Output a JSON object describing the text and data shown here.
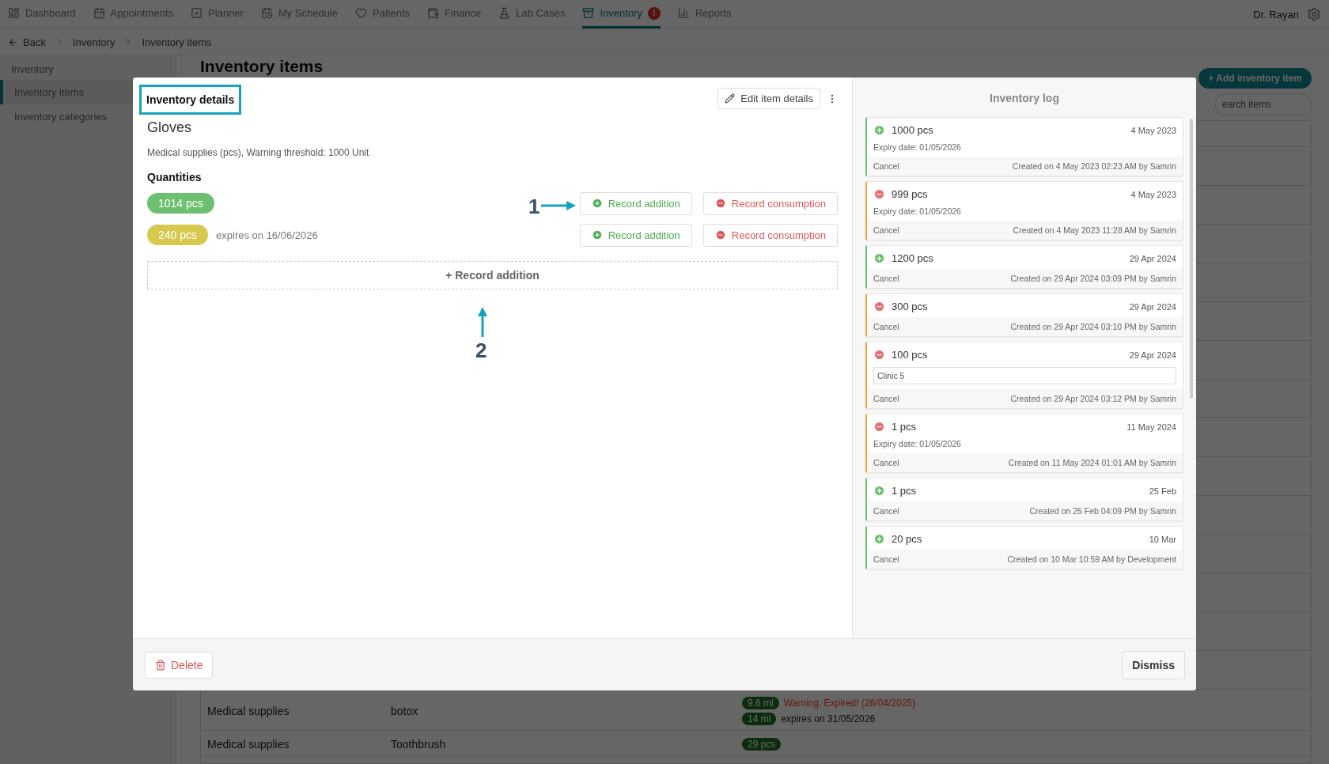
{
  "nav": {
    "items": [
      {
        "label": "Dashboard",
        "selected": false
      },
      {
        "label": "Appointments",
        "selected": false
      },
      {
        "label": "Planner",
        "selected": false
      },
      {
        "label": "My Schedule",
        "selected": false
      },
      {
        "label": "Patients",
        "selected": false
      },
      {
        "label": "Finance",
        "selected": false
      },
      {
        "label": "Lab Cases",
        "selected": false
      },
      {
        "label": "Inventory",
        "selected": true,
        "badge": "!"
      },
      {
        "label": "Reports",
        "selected": false
      }
    ],
    "user": "Dr. Rayan"
  },
  "breadcrumb": {
    "back": "Back",
    "items": [
      "Inventory",
      "Inventory items"
    ]
  },
  "sidebar": {
    "heading": "Inventory",
    "items": [
      {
        "label": "Inventory items",
        "selected": true
      },
      {
        "label": "Inventory categories",
        "selected": false
      }
    ]
  },
  "page": {
    "title": "Inventory items",
    "add_button": "+ Add inventory item",
    "search": {
      "placeholder": "earch items"
    },
    "rows": [
      {
        "category": "Medical supplies",
        "name": "botox",
        "quantities": [
          {
            "amount": "9.6 ml",
            "note": "Warning. Expired! (26/04/2025)",
            "kind": "expired"
          },
          {
            "amount": "14 ml",
            "note": "expires on 31/05/2026",
            "kind": "valid"
          }
        ]
      },
      {
        "category": "Medical supplies",
        "name": "Toothbrush",
        "quantities": [
          {
            "amount": "29 pcs"
          }
        ]
      }
    ]
  },
  "modal": {
    "title": "Inventory details",
    "title_highlighted": true,
    "edit_button": "Edit item details",
    "item_name": "Gloves",
    "description": "Medical supplies (pcs), Warning threshold: 1000 Unit",
    "quantities_heading": "Quantities",
    "quantities": [
      {
        "amount": "1014 pcs",
        "color": "#6cc070",
        "add": "Record addition",
        "consume": "Record consumption"
      },
      {
        "amount": "240 pcs",
        "color": "#d6c94e",
        "expiry": "expires on 16/06/2026",
        "add": "Record addition",
        "consume": "Record consumption"
      }
    ],
    "record_addition": "+ Record addition",
    "annotations": [
      {
        "label": "1",
        "kind": "arrow_right"
      },
      {
        "label": "2",
        "kind": "arrow_up"
      }
    ],
    "log": {
      "title": "Inventory log",
      "entries": [
        {
          "kind": "addition",
          "amount": "1000 pcs",
          "date": "4 May 2023",
          "expiry": "Expiry date: 01/05/2026",
          "cancel": "Cancel",
          "created": "Created on 4 May 2023 02:23 AM by Samrin"
        },
        {
          "kind": "consumption",
          "amount": "999 pcs",
          "date": "4 May 2023",
          "expiry": "Expiry date: 01/05/2026",
          "cancel": "Cancel",
          "created": "Created on 4 May 2023 11:28 AM by Samrin"
        },
        {
          "kind": "addition",
          "amount": "1200 pcs",
          "date": "29 Apr 2024",
          "cancel": "Cancel",
          "created": "Created on 29 Apr 2024 03:09 PM by Samrin"
        },
        {
          "kind": "consumption",
          "amount": "300 pcs",
          "date": "29 Apr 2024",
          "cancel": "Cancel",
          "created": "Created on 29 Apr 2024 03:10 PM by Samrin"
        },
        {
          "kind": "consumption",
          "amount": "100 pcs",
          "date": "29 Apr 2024",
          "note": "Clinic 5",
          "cancel": "Cancel",
          "created": "Created on 29 Apr 2024 03:12 PM by Samrin"
        },
        {
          "kind": "consumption",
          "amount": "1 pcs",
          "date": "11 May 2024",
          "expiry": "Expiry date: 01/05/2026",
          "cancel": "Cancel",
          "created": "Created on 11 May 2024 01:01 AM by Samrin"
        },
        {
          "kind": "addition",
          "amount": "1 pcs",
          "date": "25 Feb",
          "cancel": "Cancel",
          "created": "Created on 25 Feb 04:09 PM by Samrin"
        },
        {
          "kind": "addition",
          "amount": "20 pcs",
          "date": "10 Mar",
          "cancel": "Cancel",
          "created": "Created on 10 Mar 10:59 AM by Development"
        }
      ]
    },
    "delete_button": "Delete",
    "dismiss_button": "Dismiss"
  }
}
